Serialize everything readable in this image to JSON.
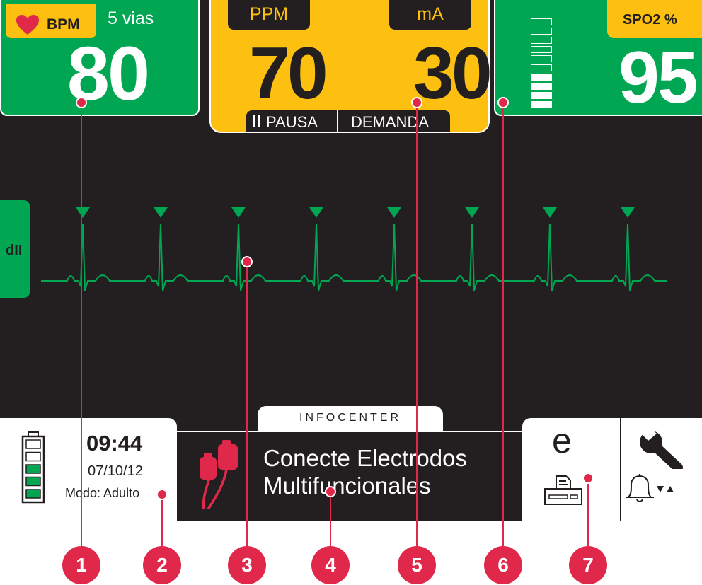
{
  "heart_rate": {
    "label": "BPM",
    "leads": "5 vias",
    "value": "80",
    "icon": "heart-icon"
  },
  "pacer": {
    "ppm_label": "PPM",
    "ma_label": "mA",
    "ppm_value": "70",
    "ma_value": "30",
    "pause_label": "PAUSA",
    "demand_label": "DEMANDA",
    "pause_icon": "pause-icon"
  },
  "spo2": {
    "label": "SPO2 %",
    "value": "95",
    "bars_total": 10,
    "bars_on": 4
  },
  "ecg": {
    "lead_label": "dII",
    "beats": 8,
    "pace_marker_icon": "triangle-down-icon"
  },
  "status": {
    "time": "09:44",
    "date": "07/10/12",
    "mode": "Modo: Adulto",
    "battery_segments_total": 5,
    "battery_segments_on": 3
  },
  "infocenter": {
    "tab_label": "INFOCENTER",
    "message_line1": "Conecte Electrodos",
    "message_line2": "Multifuncionales",
    "icon": "electrodes-icon"
  },
  "tools": {
    "event_symbol": "e",
    "icons": [
      "event-icon",
      "printer-icon",
      "wrench-icon",
      "bell-icon"
    ]
  },
  "callouts": [
    "1",
    "2",
    "3",
    "4",
    "5",
    "6",
    "7"
  ],
  "colors": {
    "green": "#00a651",
    "yellow": "#fdc010",
    "screen": "#231f20",
    "callout": "#e0284a",
    "heart": "#e0284a"
  }
}
